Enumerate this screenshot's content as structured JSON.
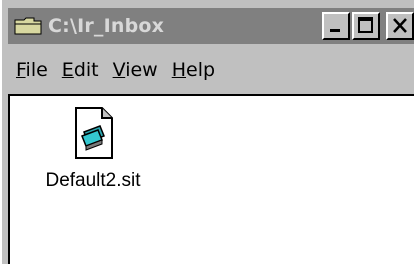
{
  "window": {
    "title": "C:\\Ir_Inbox",
    "controls": [
      "minimize",
      "maximize",
      "close"
    ],
    "title_bar_color": "#808080",
    "title_text_color": "#d8d8d8"
  },
  "menubar": {
    "items": [
      {
        "label": "File",
        "accel": "F",
        "rest": "ile"
      },
      {
        "label": "Edit",
        "accel": "E",
        "rest": "dit"
      },
      {
        "label": "View",
        "accel": "V",
        "rest": "iew"
      },
      {
        "label": "Help",
        "accel": "H",
        "rest": "elp"
      }
    ]
  },
  "content": {
    "files": [
      {
        "name": "Default2.sit",
        "icon": "stuffit-archive-icon"
      }
    ]
  }
}
